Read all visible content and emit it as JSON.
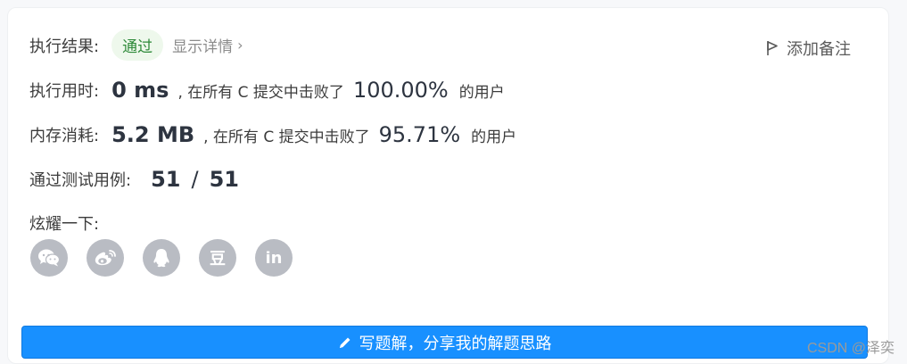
{
  "result": {
    "label": "执行结果:",
    "status": "通过",
    "details_link": "显示详情",
    "details_chevron": "›",
    "add_note": "添加备注"
  },
  "runtime": {
    "label": "执行用时:",
    "value": "0 ms",
    "middle_text": ", 在所有 C 提交中击败了",
    "percent": "100.00%",
    "suffix": "的用户"
  },
  "memory": {
    "label": "内存消耗:",
    "value": "5.2 MB",
    "middle_text": ", 在所有 C 提交中击败了",
    "percent": "95.71%",
    "suffix": "的用户"
  },
  "tests": {
    "label": "通过测试用例:",
    "passed": "51",
    "separator": "/",
    "total": "51"
  },
  "share": {
    "label": "炫耀一下:",
    "items": [
      {
        "icon": "wechat-icon"
      },
      {
        "icon": "weibo-icon"
      },
      {
        "icon": "qq-icon"
      },
      {
        "icon": "douban-icon",
        "glyph": "豆"
      },
      {
        "icon": "linkedin-icon",
        "glyph": "in"
      }
    ]
  },
  "cta": {
    "label": "写题解，分享我的解题思路"
  },
  "watermark": "CSDN @泽奕",
  "colors": {
    "primary": "#1890ff",
    "success_bg": "#eef8ec",
    "success_text": "#2f8a3a",
    "icon_bg": "#b9bcc3"
  }
}
